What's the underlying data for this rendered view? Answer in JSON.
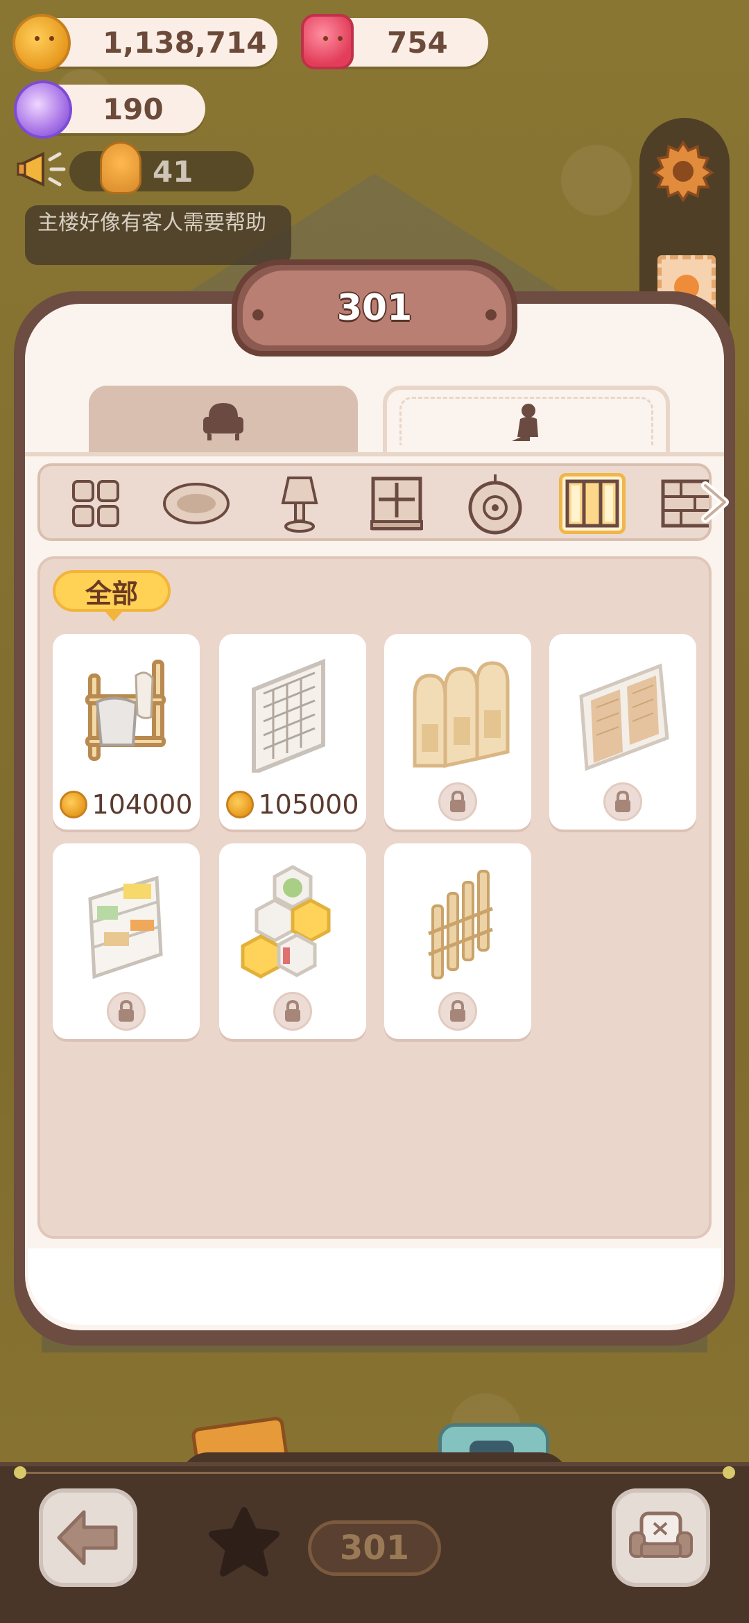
{
  "currencies": {
    "coins": "1,138,714",
    "gems": "754",
    "candy": "190"
  },
  "guests": {
    "count": "41",
    "notice": "主楼好像有客人需要帮助"
  },
  "panel": {
    "title": "301",
    "tabs": [
      {
        "icon": "armchair-icon",
        "selected": false
      },
      {
        "icon": "figure-icon",
        "selected": true
      }
    ],
    "categories": [
      {
        "icon": "window-grid-icon",
        "selected": false
      },
      {
        "icon": "rug-icon",
        "selected": false
      },
      {
        "icon": "lamp-icon",
        "selected": false
      },
      {
        "icon": "window-icon",
        "selected": false
      },
      {
        "icon": "wall-clock-icon",
        "selected": false
      },
      {
        "icon": "room-divider-icon",
        "selected": true
      },
      {
        "icon": "brick-wall-icon",
        "selected": false
      }
    ],
    "filter_label": "全部",
    "items": [
      {
        "name": "towel-rack",
        "price": "104000",
        "locked": false
      },
      {
        "name": "lattice-screen",
        "price": "105000",
        "locked": false
      },
      {
        "name": "arched-folding-screen",
        "price": null,
        "locked": true
      },
      {
        "name": "wood-panel-screen",
        "price": null,
        "locked": true
      },
      {
        "name": "storage-shelf",
        "price": null,
        "locked": true
      },
      {
        "name": "hexagon-shelf",
        "price": null,
        "locked": true
      },
      {
        "name": "bamboo-fence",
        "price": null,
        "locked": true
      }
    ]
  },
  "bottom_bar": {
    "room_number": "301"
  },
  "colors": {
    "panel_border": "#6d4c42",
    "panel_bg": "#fbf3ee",
    "accent_yellow": "#ffd155",
    "title_plate": "#b97f72"
  }
}
